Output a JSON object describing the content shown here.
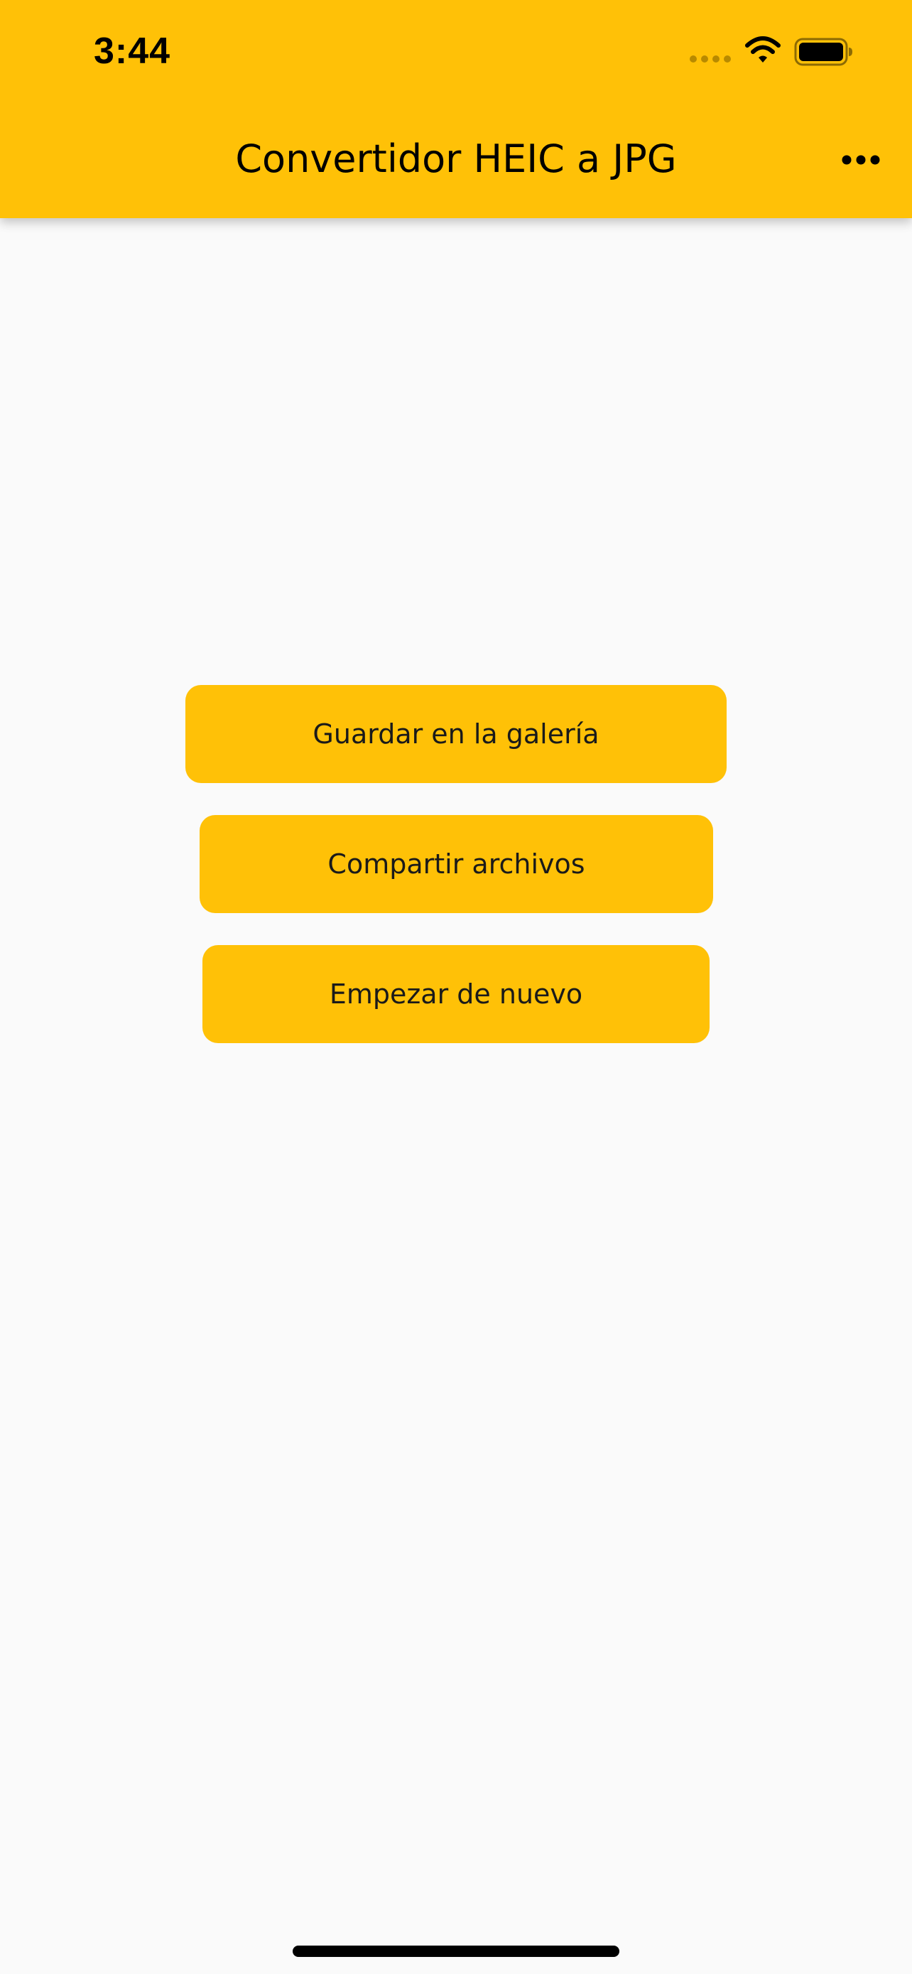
{
  "status_bar": {
    "time": "3:44",
    "signal_icon": "signal-dots-icon",
    "wifi_icon": "wifi-icon",
    "battery_icon": "battery-icon"
  },
  "app_bar": {
    "title": "Convertidor HEIC a JPG",
    "menu_icon": "more-horizontal-icon",
    "color": "#FFC107"
  },
  "actions": {
    "save_label": "Guardar en la galería",
    "share_label": "Compartir archivos",
    "restart_label": "Empezar de nuevo"
  },
  "colors": {
    "accent": "#FFC107",
    "background": "#FAFAFA",
    "text": "#1A1A1A"
  }
}
